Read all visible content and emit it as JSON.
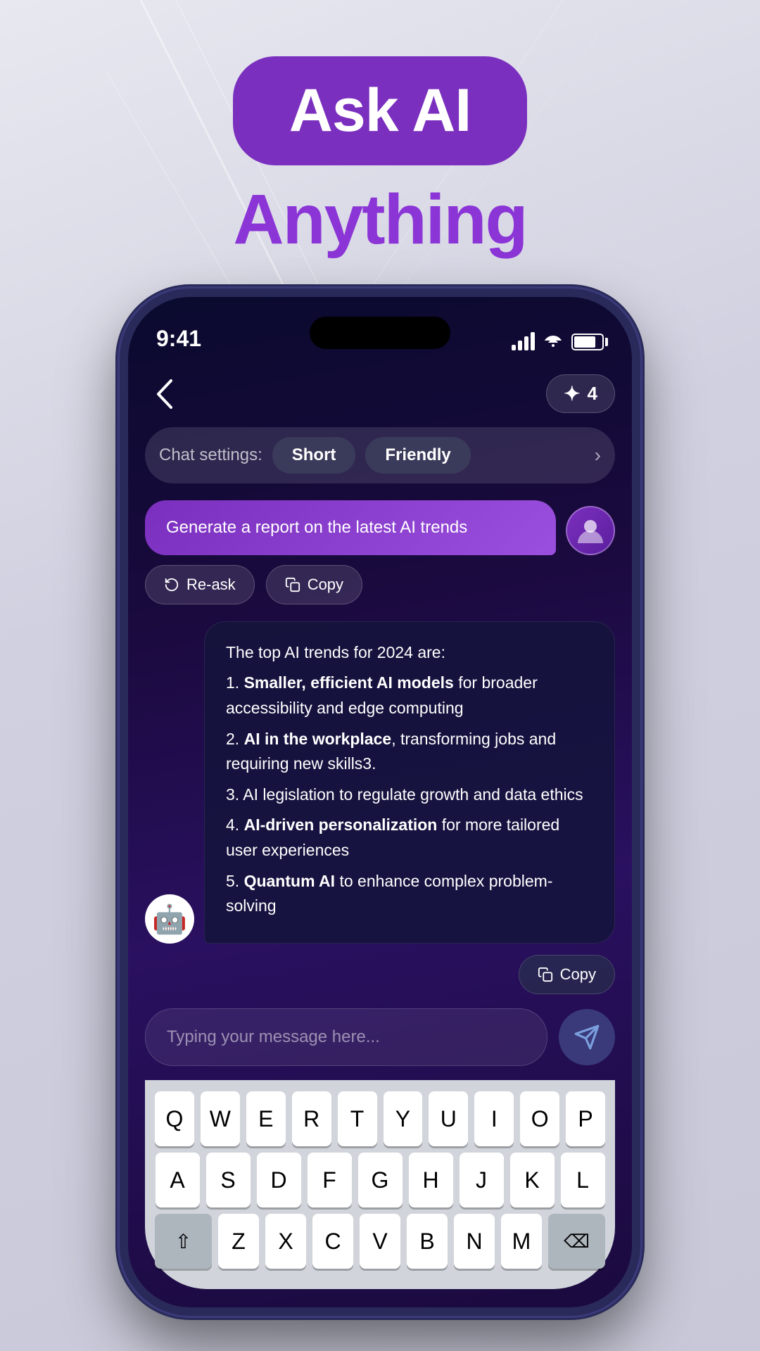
{
  "header": {
    "badge_text": "Ask AI",
    "subtitle": "Anything"
  },
  "phone": {
    "status_bar": {
      "time": "9:41",
      "signal": "4",
      "battery_percent": 80
    },
    "top_row": {
      "back_label": "‹",
      "credits_icon": "✦",
      "credits_count": "4"
    },
    "chat_settings": {
      "label": "Chat settings:",
      "chip1": "Short",
      "chip2": "Friendly"
    },
    "user_message": "Generate a report on the latest AI trends",
    "action_buttons": {
      "reask": "Re-ask",
      "copy": "Copy"
    },
    "ai_response": {
      "intro": "The top AI trends for 2024 are:",
      "items": [
        {
          "number": "1.",
          "bold": "Smaller, efficient AI models",
          "rest": " for broader accessibility and edge computing"
        },
        {
          "number": "2.",
          "bold": "AI in the workplace",
          "rest": ", transforming jobs and requiring new skills3."
        },
        {
          "number": "3.",
          "bold": "",
          "rest": "AI legislation to regulate growth and data ethics"
        },
        {
          "number": "4.",
          "bold": "AI-driven personalization",
          "rest": " for more tailored user experiences"
        },
        {
          "number": "5.",
          "bold": "Quantum AI",
          "rest": " to enhance complex problem-solving"
        }
      ]
    },
    "copy_button": "Copy",
    "input_placeholder": "Typing your message here...",
    "keyboard": {
      "row1": [
        "Q",
        "W",
        "E",
        "R",
        "T",
        "Y",
        "U",
        "I",
        "O",
        "P"
      ],
      "row2": [
        "A",
        "S",
        "D",
        "F",
        "G",
        "H",
        "J",
        "K",
        "L"
      ],
      "row3": [
        "Z",
        "X",
        "C",
        "V",
        "B",
        "N",
        "M"
      ]
    }
  }
}
